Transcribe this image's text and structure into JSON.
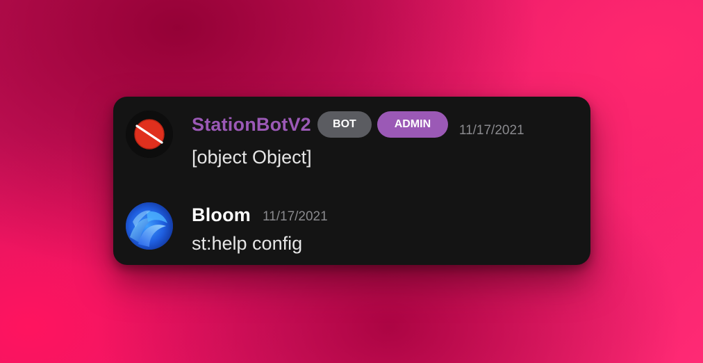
{
  "messages": [
    {
      "author": "StationBotV2",
      "badges": [
        "BOT",
        "ADMIN"
      ],
      "timestamp": "11/17/2021",
      "content": "[object Object]",
      "author_color": "#9b59b6",
      "avatar_icon": "red-slash-circle-icon"
    },
    {
      "author": "Bloom",
      "timestamp": "11/17/2021",
      "content": "st:help config",
      "author_color": "#ffffff",
      "avatar_icon": "blue-bloom-wallpaper-icon"
    }
  ],
  "colors": {
    "card_background": "#141414",
    "bot_badge": "#5b5c61",
    "admin_badge": "#9b59b6",
    "background_accent": "#e8186a"
  }
}
